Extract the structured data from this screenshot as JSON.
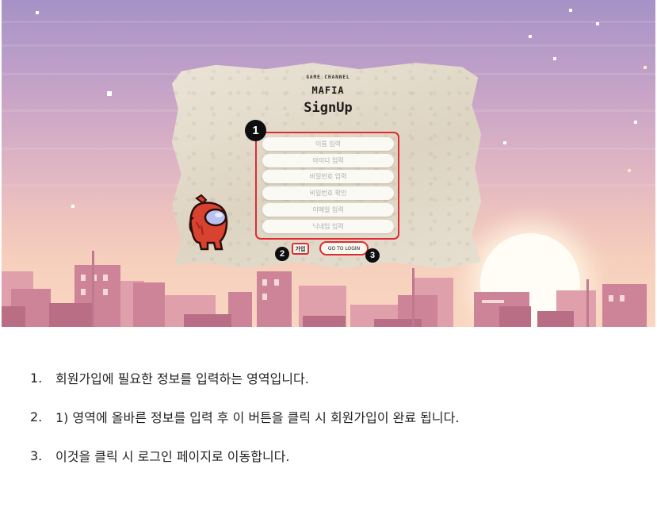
{
  "form": {
    "brand_small": "GAME CHANNEL",
    "brand": "MAFIA",
    "title": "SignUp",
    "fields": [
      {
        "placeholder": "이름 입력"
      },
      {
        "placeholder": "아이디 입력"
      },
      {
        "placeholder": "비밀번호 입력"
      },
      {
        "placeholder": "비밀번호 확인"
      },
      {
        "placeholder": "이메일 입력"
      },
      {
        "placeholder": "닉네임 입력"
      }
    ],
    "join_label": "가입",
    "login_label": "GO TO LOGIN"
  },
  "annotations": {
    "badge_1": "1",
    "badge_2": "2",
    "badge_3": "3",
    "highlight_color": "#dd2d33"
  },
  "description": [
    {
      "num": "1.",
      "text": "회원가입에 필요한 정보를 입력하는 영역입니다."
    },
    {
      "num": "2.",
      "text": "1) 영역에 올바른 정보를 입력 후 이 버튼을 클릭 시 회원가입이 완료 됩니다."
    },
    {
      "num": "3.",
      "text": "이것을 클릭 시 로그인 페이지로 이동합니다."
    }
  ],
  "colors": {
    "sky_top": "#a692c6",
    "sky_bottom": "#f9d6c1",
    "paper": "#e4dccd",
    "mascot_body": "#d8422e",
    "mascot_visor": "#b7c2f0"
  },
  "icons": {
    "mascot": "among-us-crewmate-icon"
  }
}
